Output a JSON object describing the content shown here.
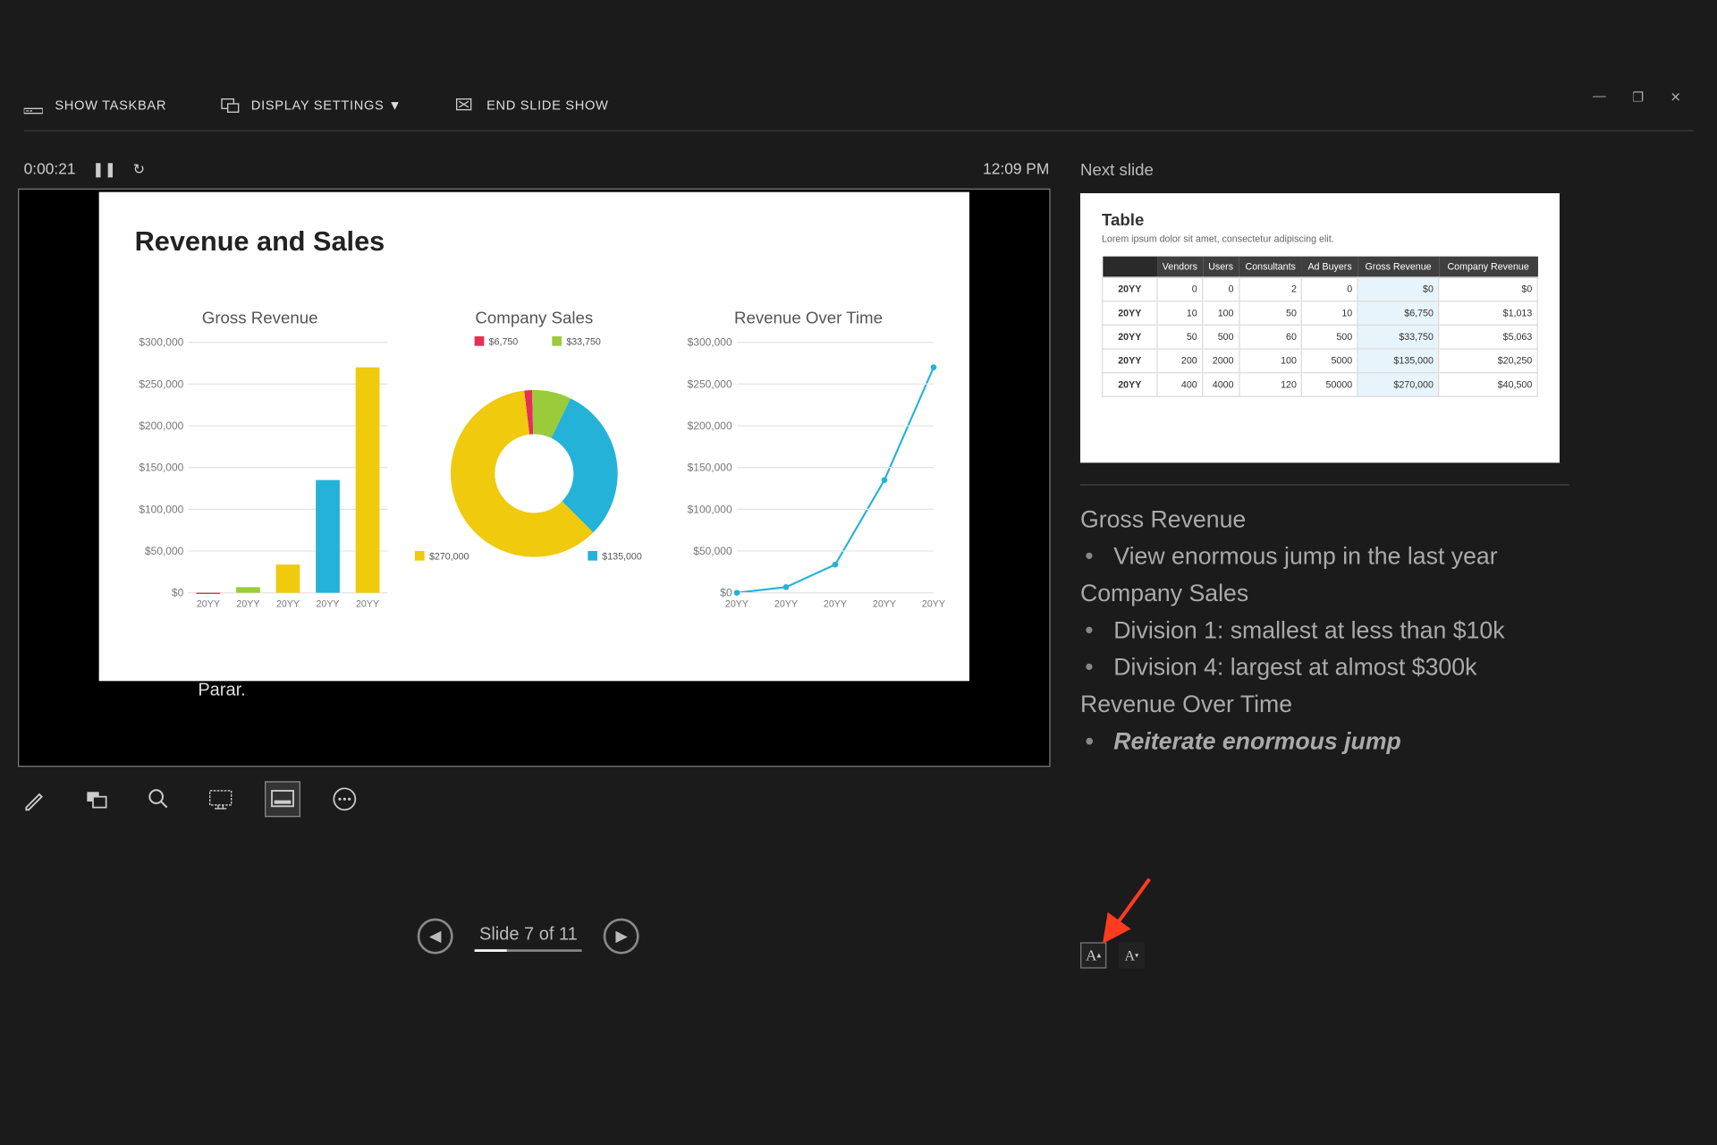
{
  "window_controls": {
    "min": "—",
    "restore": "❐",
    "close": "✕"
  },
  "toolbar": {
    "show_taskbar": "SHOW TASKBAR",
    "display_settings": "DISPLAY SETTINGS ▼",
    "end_show": "END SLIDE SHOW"
  },
  "timer": {
    "elapsed": "0:00:21",
    "clock": "12:09 PM"
  },
  "slide": {
    "title": "Revenue and Sales",
    "subtitle": "Parar.",
    "chart1_title": "Gross Revenue",
    "chart2_title": "Company Sales",
    "chart3_title": "Revenue Over Time"
  },
  "nav": {
    "label": "Slide 7 of 11"
  },
  "right": {
    "next_label": "Next slide",
    "table_title": "Table",
    "table_sub": "Lorem ipsum dolor sit amet, consectetur adipiscing elit.",
    "headers": [
      "",
      "Vendors",
      "Users",
      "Consultants",
      "Ad Buyers",
      "Gross Revenue",
      "Company Revenue"
    ],
    "rows": [
      [
        "20YY",
        "0",
        "0",
        "2",
        "0",
        "$0",
        "$0"
      ],
      [
        "20YY",
        "10",
        "100",
        "50",
        "10",
        "$6,750",
        "$1,013"
      ],
      [
        "20YY",
        "50",
        "500",
        "60",
        "500",
        "$33,750",
        "$5,063"
      ],
      [
        "20YY",
        "200",
        "2000",
        "100",
        "5000",
        "$135,000",
        "$20,250"
      ],
      [
        "20YY",
        "400",
        "4000",
        "120",
        "50000",
        "$270,000",
        "$40,500"
      ]
    ]
  },
  "notes": {
    "h1": "Gross Revenue",
    "b1": "View enormous jump in the last year",
    "h2": "Company Sales",
    "b2": "Division 1: smallest at less than $10k",
    "b3": "Division 4: largest at almost $300k",
    "h3": "Revenue Over Time",
    "b4": "Reiterate enormous jump"
  },
  "chart_data": [
    {
      "type": "bar",
      "title": "Gross Revenue",
      "categories": [
        "20YY",
        "20YY",
        "20YY",
        "20YY",
        "20YY"
      ],
      "values": [
        0,
        6750,
        33750,
        135000,
        270000
      ],
      "colors": [
        "#e62e56",
        "#9acb3b",
        "#efca0d",
        "#24b2d8",
        "#efca0d"
      ],
      "ylim": [
        0,
        300000
      ],
      "yticks": [
        0,
        50000,
        100000,
        150000,
        200000,
        250000,
        300000
      ],
      "ylabels": [
        "$0",
        "$50,000",
        "$100,000",
        "$150,000",
        "$200,000",
        "$250,000",
        "$300,000"
      ]
    },
    {
      "type": "pie",
      "title": "Company Sales",
      "series": [
        {
          "name": "$6,750",
          "value": 6750,
          "color": "#e62e56"
        },
        {
          "name": "$33,750",
          "value": 33750,
          "color": "#9acb3b"
        },
        {
          "name": "$135,000",
          "value": 135000,
          "color": "#24b2d8"
        },
        {
          "name": "$270,000",
          "value": 270000,
          "color": "#efca0d"
        }
      ],
      "donut": true
    },
    {
      "type": "line",
      "title": "Revenue Over Time",
      "categories": [
        "20YY",
        "20YY",
        "20YY",
        "20YY",
        "20YY"
      ],
      "values": [
        0,
        6750,
        33750,
        135000,
        270000
      ],
      "color": "#24b2d8",
      "ylim": [
        0,
        300000
      ],
      "yticks": [
        0,
        50000,
        100000,
        150000,
        200000,
        250000,
        300000
      ],
      "ylabels": [
        "$0",
        "$50,000",
        "$100,000",
        "$150,000",
        "$200,000",
        "$250,000",
        "$300,000"
      ]
    }
  ]
}
